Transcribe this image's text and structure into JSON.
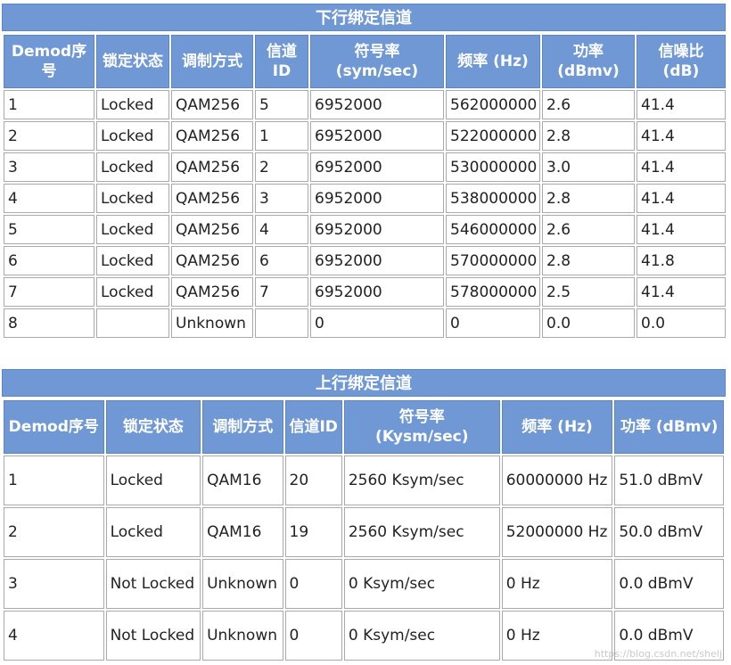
{
  "downstream": {
    "title": "下行绑定信道",
    "headers": [
      "Demod序号",
      "锁定状态",
      "调制方式",
      "信道ID",
      "符号率\n(sym/sec)",
      "频率 (Hz)",
      "功率\n(dBmv)",
      "信噪比\n(dB)"
    ],
    "rows": [
      [
        "1",
        "Locked",
        "QAM256",
        "5",
        "6952000",
        "562000000",
        "2.6",
        "41.4"
      ],
      [
        "2",
        "Locked",
        "QAM256",
        "1",
        "6952000",
        "522000000",
        "2.8",
        "41.4"
      ],
      [
        "3",
        "Locked",
        "QAM256",
        "2",
        "6952000",
        "530000000",
        "3.0",
        "41.4"
      ],
      [
        "4",
        "Locked",
        "QAM256",
        "3",
        "6952000",
        "538000000",
        "2.8",
        "41.4"
      ],
      [
        "5",
        "Locked",
        "QAM256",
        "4",
        "6952000",
        "546000000",
        "2.6",
        "41.4"
      ],
      [
        "6",
        "Locked",
        "QAM256",
        "6",
        "6952000",
        "570000000",
        "2.8",
        "41.8"
      ],
      [
        "7",
        "Locked",
        "QAM256",
        "7",
        "6952000",
        "578000000",
        "2.5",
        "41.4"
      ],
      [
        "8",
        "",
        "Unknown",
        "",
        "0",
        "0",
        "0.0",
        "0.0"
      ]
    ]
  },
  "upstream": {
    "title": "上行绑定信道",
    "headers": [
      "Demod序号",
      "锁定状态",
      "调制方式",
      "信道ID",
      "符号率\n(Kysm/sec)",
      "频率 (Hz)",
      "功率 (dBmv)"
    ],
    "rows": [
      [
        "1",
        "Locked",
        "QAM16",
        "20",
        "2560 Ksym/sec",
        "60000000 Hz",
        "51.0 dBmV"
      ],
      [
        "2",
        "Locked",
        "QAM16",
        "19",
        "2560 Ksym/sec",
        "52000000 Hz",
        "50.0 dBmV"
      ],
      [
        "3",
        "Not Locked",
        "Unknown",
        "0",
        "0 Ksym/sec",
        "0 Hz",
        "0.0 dBmV"
      ],
      [
        "4",
        "Not Locked",
        "Unknown",
        "0",
        "0 Ksym/sec",
        "0 Hz",
        "0.0 dBmV"
      ]
    ]
  },
  "watermark": "https://blog.csdn.net/shelj"
}
